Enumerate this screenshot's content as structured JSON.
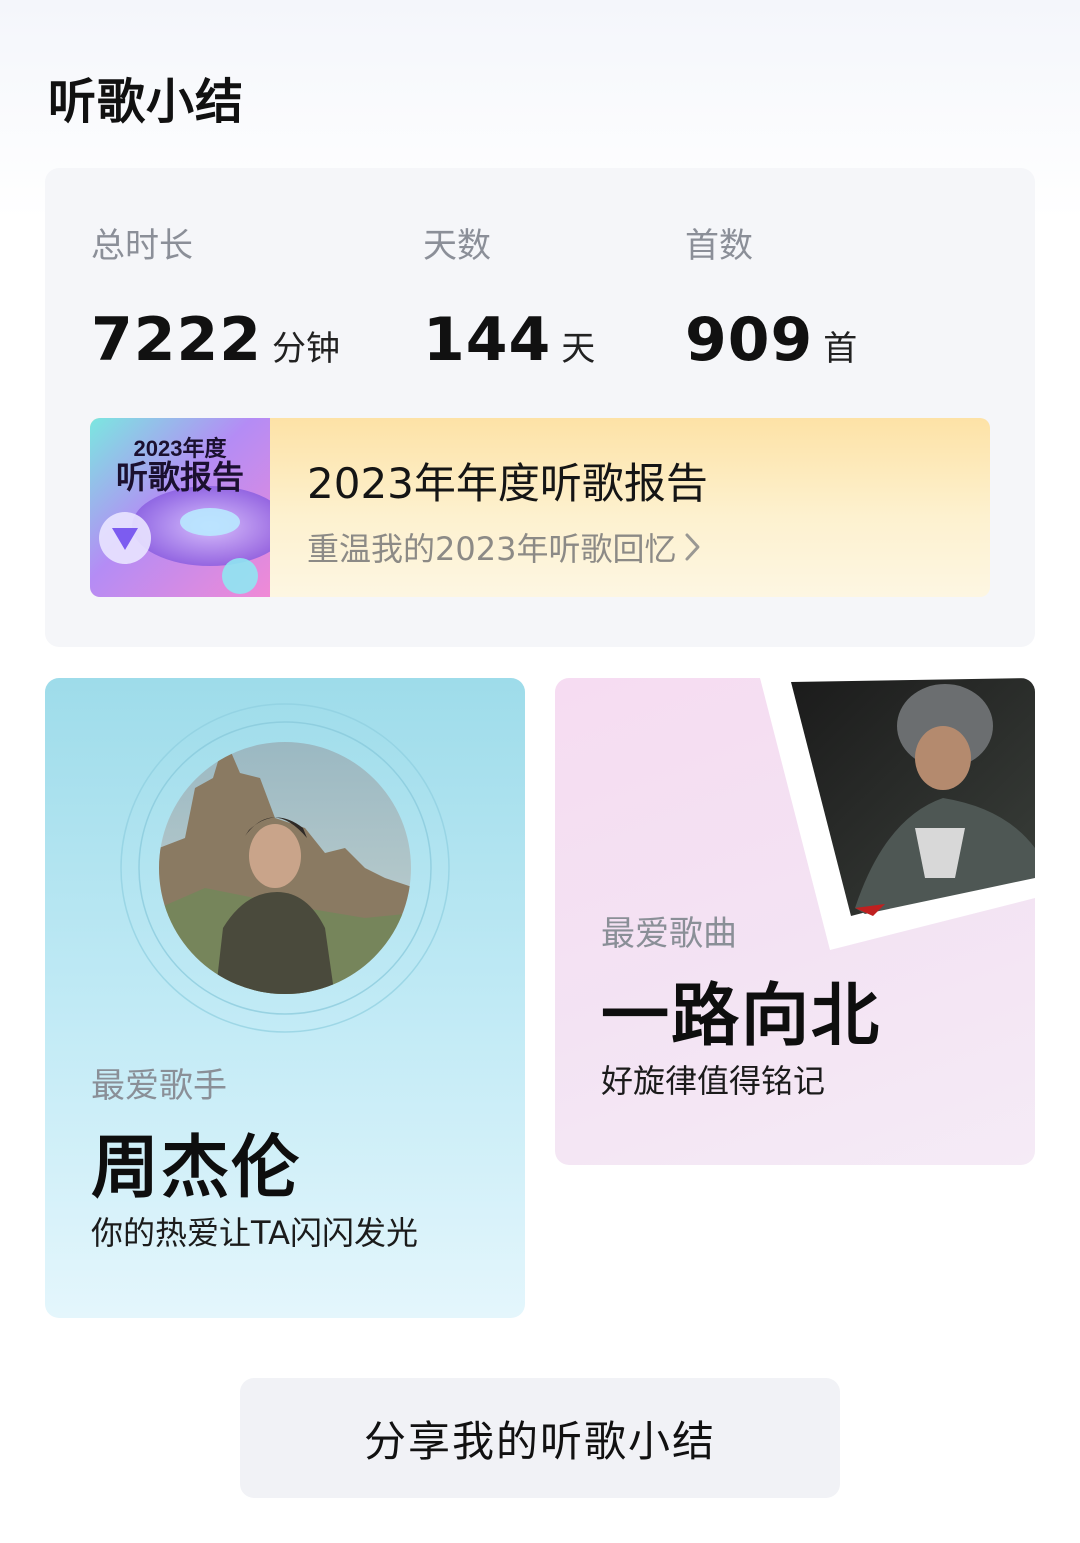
{
  "page": {
    "title": "听歌小结"
  },
  "stats": {
    "duration": {
      "label": "总时长",
      "value": "7222",
      "unit": "分钟"
    },
    "days": {
      "label": "天数",
      "value": "144",
      "unit": "天"
    },
    "songs": {
      "label": "首数",
      "value": "909",
      "unit": "首"
    }
  },
  "report": {
    "thumb_line1": "2023年度",
    "thumb_line2": "听歌报告",
    "title": "2023年年度听歌报告",
    "subtitle": "重温我的2023年听歌回忆"
  },
  "favorite_artist": {
    "label": "最爱歌手",
    "name": "周杰伦",
    "desc": "你的热爱让TA闪闪发光"
  },
  "favorite_song": {
    "label": "最爱歌曲",
    "name": "一路向北",
    "desc": "好旋律值得铭记"
  },
  "share": {
    "label": "分享我的听歌小结"
  },
  "colors": {
    "artist_card": "#b5e4f1",
    "song_card": "#f4e0f3",
    "report_banner": "#fde9b8",
    "stats_card": "#f5f6f9"
  }
}
